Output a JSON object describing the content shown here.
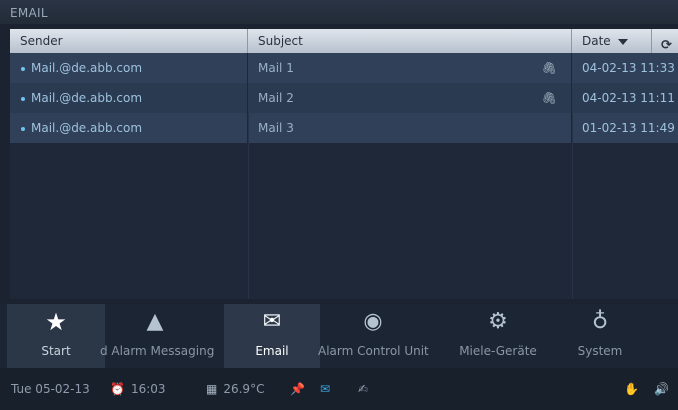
{
  "window": {
    "title": "EMAIL"
  },
  "table": {
    "headers": {
      "sender": "Sender",
      "subject": "Subject",
      "date": "Date"
    },
    "rows": [
      {
        "sender": "Mail.@de.abb.com",
        "subject": "Mail 1",
        "attachment": true,
        "date": "04-02-13 11:33"
      },
      {
        "sender": "Mail.@de.abb.com",
        "subject": "Mail 2",
        "attachment": true,
        "date": "04-02-13 11:11"
      },
      {
        "sender": "Mail.@de.abb.com",
        "subject": "Mail 3",
        "attachment": false,
        "date": "01-02-13 11:49"
      }
    ]
  },
  "nav": {
    "items": [
      {
        "label": "Start",
        "icon": "star-icon"
      },
      {
        "label": "d Alarm Messaging",
        "icon": "siren-icon"
      },
      {
        "label": "Email",
        "icon": "email-icon"
      },
      {
        "label": "Alarm Control Unit",
        "icon": "eye-icon"
      },
      {
        "label": "Miele-Geräte",
        "icon": "tools-icon"
      },
      {
        "label": "System",
        "icon": "system-icon"
      }
    ]
  },
  "status": {
    "date": "Tue 05-02-13",
    "time": "16:03",
    "temperature": "26.9°C"
  },
  "colors": {
    "accent": "#3aa8e0",
    "header_bg": "#c8d0da",
    "row_bg": "#2f4058"
  }
}
